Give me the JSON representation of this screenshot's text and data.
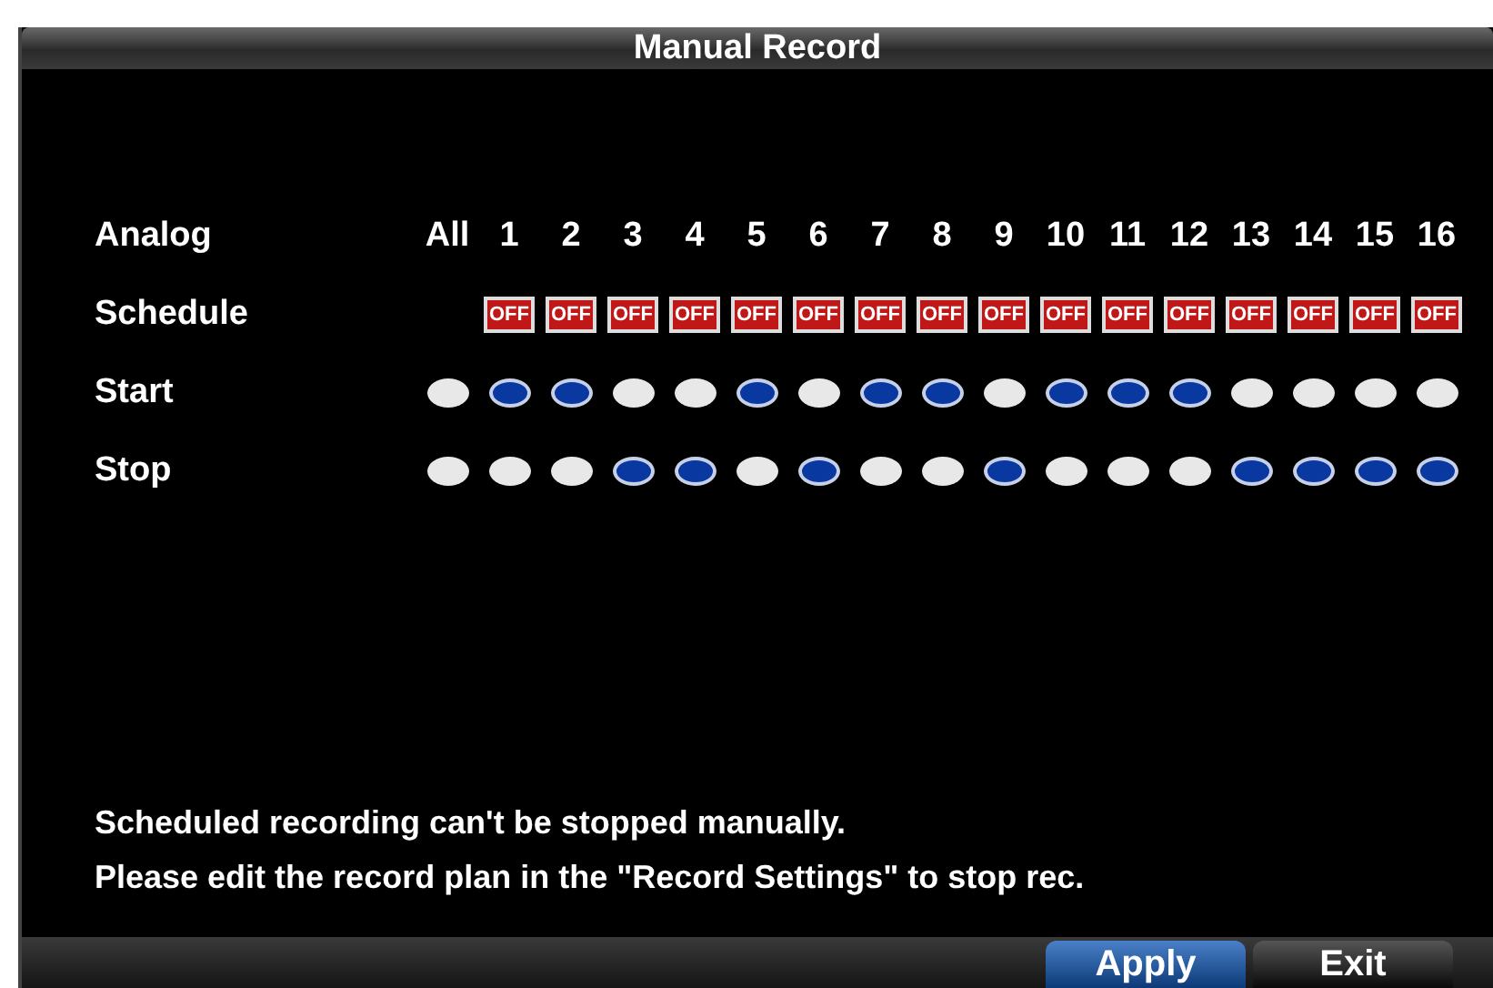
{
  "window": {
    "title": "Manual Record"
  },
  "header": {
    "label": "Analog",
    "columns": [
      "All",
      "1",
      "2",
      "3",
      "4",
      "5",
      "6",
      "7",
      "8",
      "9",
      "10",
      "11",
      "12",
      "13",
      "14",
      "15",
      "16"
    ]
  },
  "schedule": {
    "label": "Schedule",
    "switches": [
      {
        "text": "OFF",
        "on": false
      },
      {
        "text": "OFF",
        "on": false
      },
      {
        "text": "OFF",
        "on": false
      },
      {
        "text": "OFF",
        "on": false
      },
      {
        "text": "OFF",
        "on": false
      },
      {
        "text": "OFF",
        "on": false
      },
      {
        "text": "OFF",
        "on": false
      },
      {
        "text": "OFF",
        "on": false
      },
      {
        "text": "OFF",
        "on": false
      },
      {
        "text": "OFF",
        "on": false
      },
      {
        "text": "OFF",
        "on": false
      },
      {
        "text": "OFF",
        "on": false
      },
      {
        "text": "OFF",
        "on": false
      },
      {
        "text": "OFF",
        "on": false
      },
      {
        "text": "OFF",
        "on": false
      },
      {
        "text": "OFF",
        "on": false
      }
    ]
  },
  "rows": [
    {
      "label": "Start",
      "options": [
        {
          "selected": false
        },
        {
          "selected": true
        },
        {
          "selected": true
        },
        {
          "selected": false
        },
        {
          "selected": false
        },
        {
          "selected": true
        },
        {
          "selected": false
        },
        {
          "selected": true
        },
        {
          "selected": true
        },
        {
          "selected": false
        },
        {
          "selected": true
        },
        {
          "selected": true
        },
        {
          "selected": true
        },
        {
          "selected": false
        },
        {
          "selected": false
        },
        {
          "selected": false
        },
        {
          "selected": false
        }
      ]
    },
    {
      "label": "Stop",
      "options": [
        {
          "selected": false
        },
        {
          "selected": false
        },
        {
          "selected": false
        },
        {
          "selected": true
        },
        {
          "selected": true
        },
        {
          "selected": false
        },
        {
          "selected": true
        },
        {
          "selected": false
        },
        {
          "selected": false
        },
        {
          "selected": true
        },
        {
          "selected": false
        },
        {
          "selected": false
        },
        {
          "selected": false
        },
        {
          "selected": true
        },
        {
          "selected": true
        },
        {
          "selected": true
        },
        {
          "selected": true
        }
      ]
    }
  ],
  "notes": [
    "Scheduled recording can't be stopped manually.",
    "Please edit the record plan in the \"Record Settings\" to stop rec."
  ],
  "buttons": [
    {
      "label": "Apply",
      "selected": true
    },
    {
      "label": "Exit",
      "selected": false
    }
  ]
}
